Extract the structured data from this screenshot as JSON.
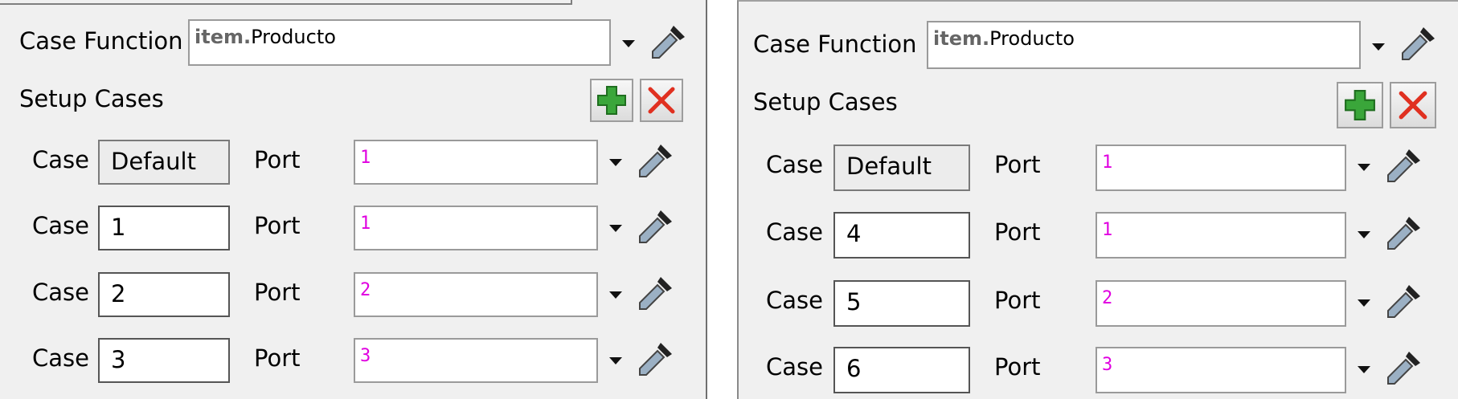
{
  "panels": [
    {
      "case_function": {
        "label": "Case Function",
        "value_keyword": "item.",
        "value_rest": "Producto"
      },
      "setup_cases": {
        "label": "Setup Cases"
      },
      "rows": [
        {
          "case_label": "Case",
          "case_value": "Default",
          "port_label": "Port",
          "port_value": "1"
        },
        {
          "case_label": "Case",
          "case_value": "1",
          "port_label": "Port",
          "port_value": "1"
        },
        {
          "case_label": "Case",
          "case_value": "2",
          "port_label": "Port",
          "port_value": "2"
        },
        {
          "case_label": "Case",
          "case_value": "3",
          "port_label": "Port",
          "port_value": "3"
        }
      ]
    },
    {
      "case_function": {
        "label": "Case Function",
        "value_keyword": "item.",
        "value_rest": "Producto"
      },
      "setup_cases": {
        "label": "Setup Cases"
      },
      "rows": [
        {
          "case_label": "Case",
          "case_value": "Default",
          "port_label": "Port",
          "port_value": "1"
        },
        {
          "case_label": "Case",
          "case_value": "4",
          "port_label": "Port",
          "port_value": "1"
        },
        {
          "case_label": "Case",
          "case_value": "5",
          "port_label": "Port",
          "port_value": "2"
        },
        {
          "case_label": "Case",
          "case_value": "6",
          "port_label": "Port",
          "port_value": "3"
        }
      ]
    }
  ],
  "icons": {
    "add": "plus-icon",
    "remove": "x-icon",
    "picker": "eyedropper-icon",
    "dropdown": "chevron-down-icon"
  },
  "colors": {
    "add_green": "#3aa63a",
    "remove_red": "#e03020",
    "port_text": "#e000e0"
  }
}
